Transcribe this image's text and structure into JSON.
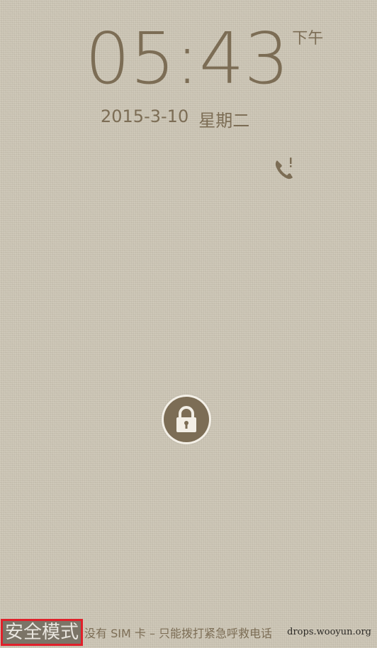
{
  "clock": {
    "time": "05:43",
    "ampm": "下午"
  },
  "date": {
    "date": "2015-3-10",
    "weekday": "星期二"
  },
  "notifications": {
    "missed_call_icon": "missed-call-icon"
  },
  "unlock": {
    "icon": "lock-icon"
  },
  "status": {
    "safe_mode": "安全模式",
    "sim_message": "没有 SIM 卡 – 只能拨打紧急呼救电话",
    "watermark": "drops.wooyun.org"
  },
  "colors": {
    "text": "#7c6d55",
    "safe_mode_border": "#e0202a",
    "background": "#cdc6b5"
  }
}
